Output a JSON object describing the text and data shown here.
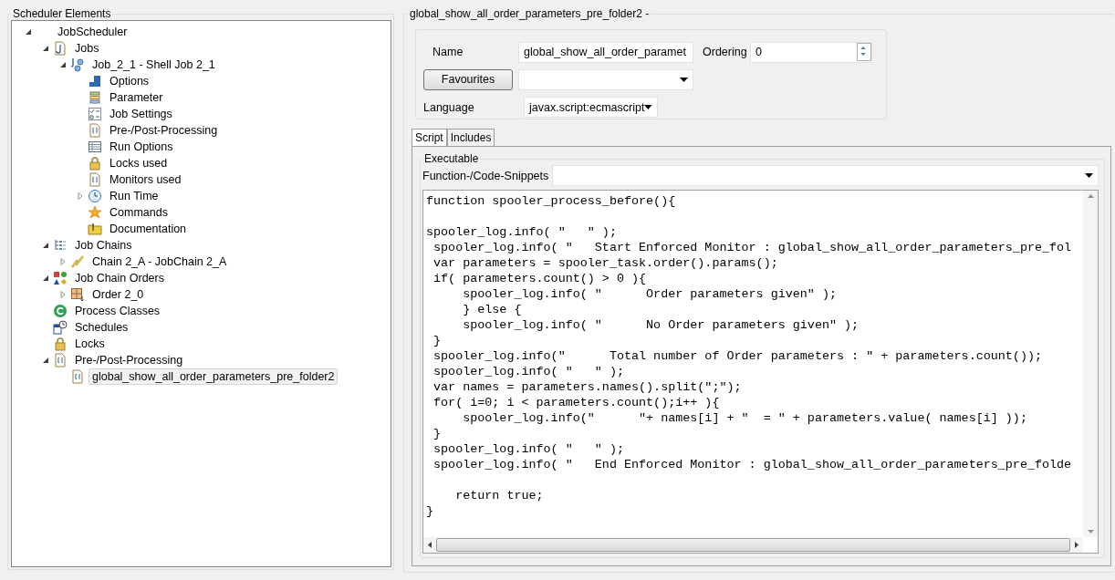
{
  "left_panel": {
    "title": "Scheduler Elements",
    "tree": [
      {
        "label": "JobScheduler",
        "kind": "root",
        "selected": false,
        "expanded": true,
        "children": [
          {
            "label": "Jobs",
            "kind": "jobs",
            "selected": false,
            "expanded": true,
            "children": [
              {
                "label": "Job_2_1 - Shell Job 2_1",
                "kind": "job",
                "selected": false,
                "expanded": true,
                "children": [
                  {
                    "label": "Options",
                    "kind": "options",
                    "selected": false
                  },
                  {
                    "label": "Parameter",
                    "kind": "parameter",
                    "selected": false
                  },
                  {
                    "label": "Job Settings",
                    "kind": "settings",
                    "selected": false
                  },
                  {
                    "label": "Pre-/Post-Processing",
                    "kind": "script",
                    "selected": false
                  },
                  {
                    "label": "Run Options",
                    "kind": "table",
                    "selected": false
                  },
                  {
                    "label": "Locks used",
                    "kind": "lock",
                    "selected": false
                  },
                  {
                    "label": "Monitors used",
                    "kind": "script",
                    "selected": false
                  },
                  {
                    "label": "Run Time",
                    "kind": "clock",
                    "selected": false,
                    "expanded": false
                  },
                  {
                    "label": "Commands",
                    "kind": "star",
                    "selected": false
                  },
                  {
                    "label": "Documentation",
                    "kind": "docs",
                    "selected": false
                  }
                ]
              }
            ]
          },
          {
            "label": "Job Chains",
            "kind": "chains",
            "selected": false,
            "expanded": true,
            "children": [
              {
                "label": "Chain 2_A - JobChain 2_A",
                "kind": "chain",
                "selected": false,
                "expanded": false
              }
            ]
          },
          {
            "label": "Job Chain Orders",
            "kind": "orders",
            "selected": false,
            "expanded": true,
            "children": [
              {
                "label": "Order 2_0",
                "kind": "order",
                "selected": false,
                "expanded": false
              }
            ]
          },
          {
            "label": "Process Classes",
            "kind": "process",
            "selected": false
          },
          {
            "label": "Schedules",
            "kind": "schedules",
            "selected": false
          },
          {
            "label": "Locks",
            "kind": "lock",
            "selected": false
          },
          {
            "label": "Pre-/Post-Processing",
            "kind": "script",
            "selected": false,
            "expanded": true,
            "children": [
              {
                "label": "global_show_all_order_parameters_pre_folder2",
                "kind": "script",
                "selected": true
              }
            ]
          }
        ]
      }
    ]
  },
  "detail": {
    "title": "global_show_all_order_parameters_pre_folder2 -",
    "name_label": "Name",
    "name_value": "global_show_all_order_paramet",
    "ordering_label": "Ordering",
    "ordering_value": "0",
    "favourites_button": "Favourites",
    "language_label": "Language",
    "language_value": "javax.script:ecmascript",
    "tabs": [
      {
        "label": "Script",
        "selected": true
      },
      {
        "label": "Includes",
        "selected": false
      }
    ],
    "group_title": "Executable",
    "snippets_label": "Function-/Code-Snippets",
    "code_blocks": [
      [
        "function spooler_process_before(){"
      ],
      [
        "spooler_log.info( \"   \" );",
        " spooler_log.info( \"   Start Enforced Monitor : global_show_all_order_parameters_pre_fol",
        " var parameters = spooler_task.order().params();",
        " if( parameters.count() > 0 ){",
        "     spooler_log.info( \"      Order parameters given\" );",
        "     } else {",
        "     spooler_log.info( \"      No Order parameters given\" );",
        " }",
        " spooler_log.info(\"      Total number of Order parameters : \" + parameters.count());",
        " spooler_log.info( \"   \" );",
        " var names = parameters.names().split(\";\");",
        " for( i=0; i < parameters.count();i++ ){",
        "     spooler_log.info(\"      \"+ names[i] + \"  = \" + parameters.value( names[i] ));",
        " }",
        " spooler_log.info( \"   \" );",
        " spooler_log.info( \"   End Enforced Monitor : global_show_all_order_parameters_pre_folde"
      ],
      [
        "    return true;",
        "}"
      ]
    ]
  }
}
